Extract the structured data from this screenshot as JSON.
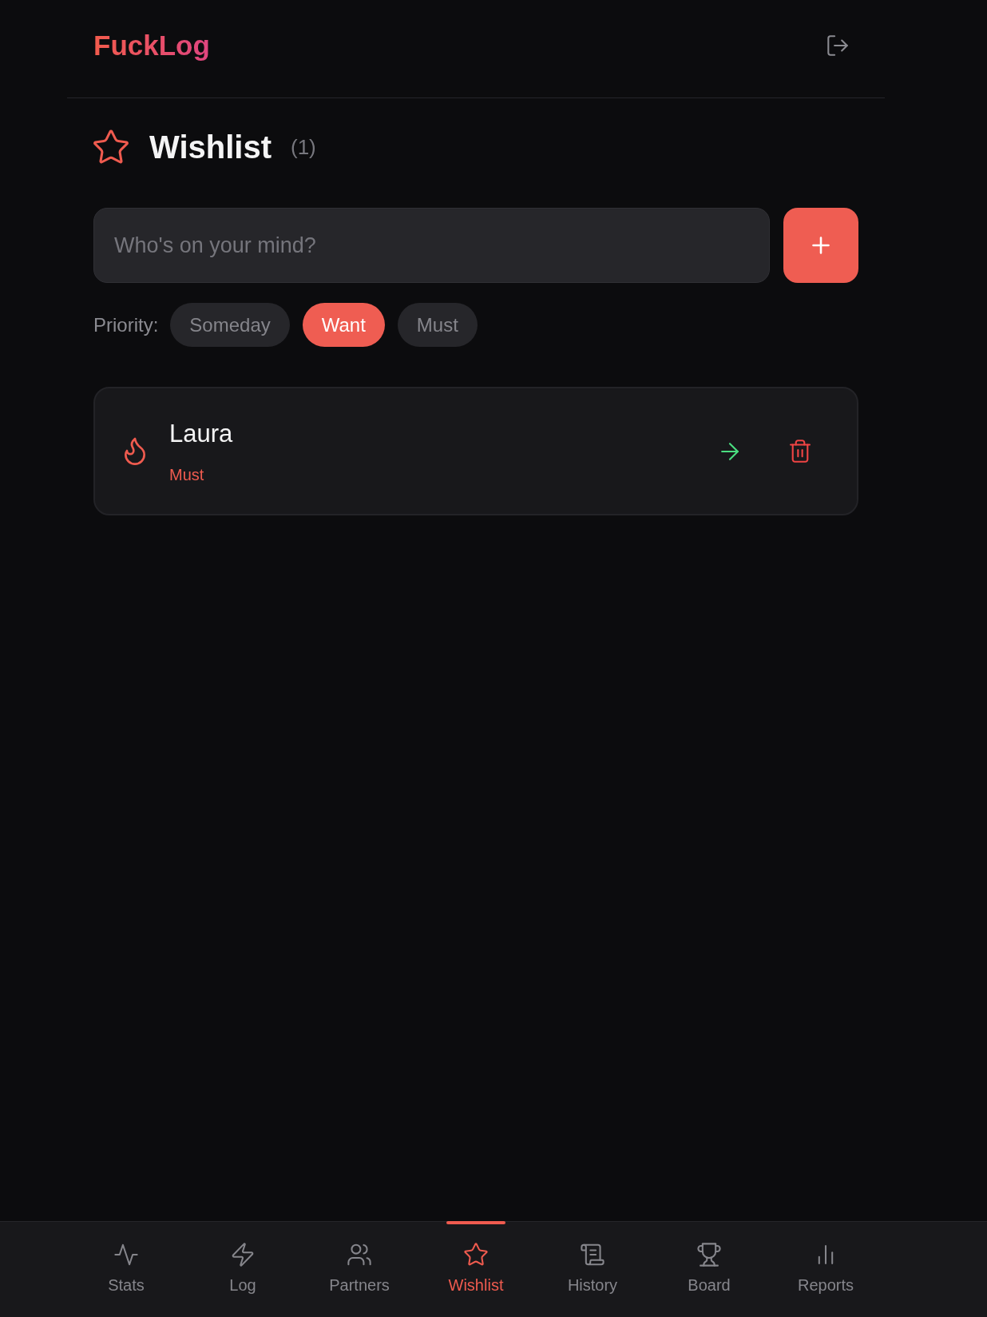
{
  "header": {
    "logo": "FuckLog"
  },
  "heading": {
    "title": "Wishlist",
    "count": "(1)"
  },
  "add_form": {
    "placeholder": "Who's on your mind?"
  },
  "priority": {
    "label": "Priority:",
    "options": [
      {
        "label": "Someday",
        "selected": false
      },
      {
        "label": "Want",
        "selected": true
      },
      {
        "label": "Must",
        "selected": false
      }
    ]
  },
  "wishlist": [
    {
      "name": "Laura",
      "priority": "Must"
    }
  ],
  "bottom_nav": [
    {
      "label": "Stats",
      "selected": false
    },
    {
      "label": "Log",
      "selected": false
    },
    {
      "label": "Partners",
      "selected": false
    },
    {
      "label": "Wishlist",
      "selected": true
    },
    {
      "label": "History",
      "selected": false
    },
    {
      "label": "Board",
      "selected": false
    },
    {
      "label": "Reports",
      "selected": false
    }
  ]
}
